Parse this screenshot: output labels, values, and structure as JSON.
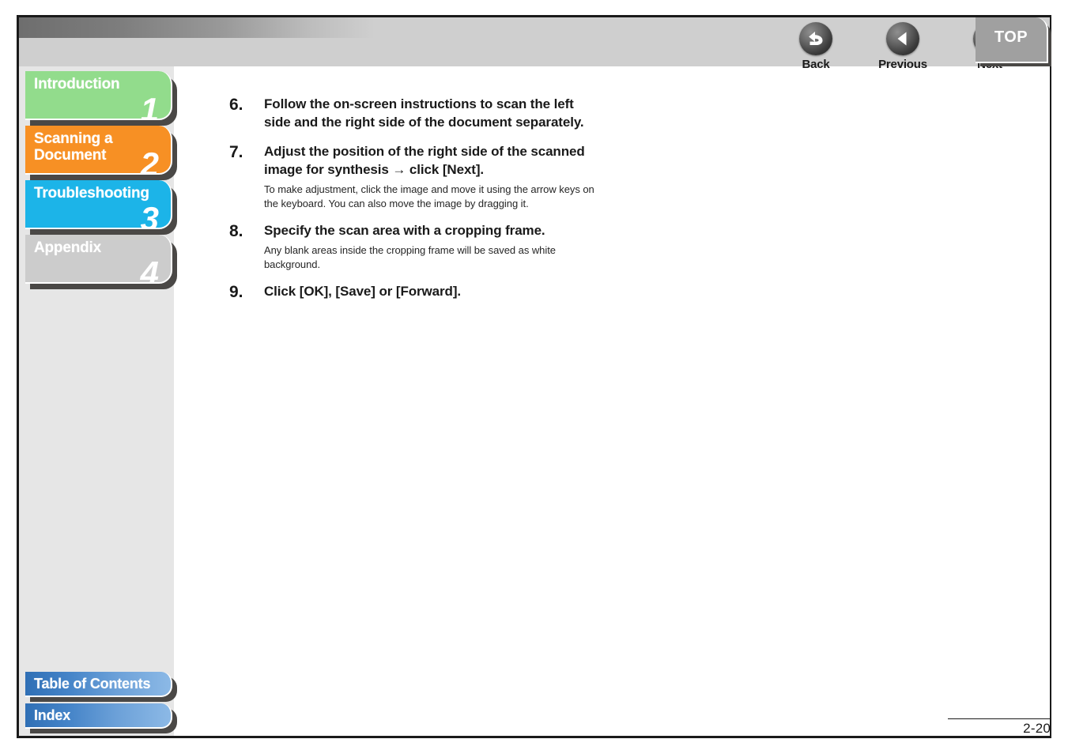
{
  "document": {
    "page_number": "2-20"
  },
  "header": {
    "nav_buttons": [
      {
        "label": "Back",
        "icon": "back-arrow-icon"
      },
      {
        "label": "Previous",
        "icon": "left-triangle-icon"
      },
      {
        "label": "Next",
        "icon": "right-triangle-icon"
      }
    ],
    "top_tab": {
      "label": "TOP",
      "color": "#a0a0a0"
    }
  },
  "sidebar": {
    "chapters": [
      {
        "label": "Introduction",
        "number": "1",
        "color": "#92dc8c"
      },
      {
        "label": "Scanning a\nDocument",
        "number": "2",
        "color": "#f79024"
      },
      {
        "label": "Troubleshooting",
        "number": "3",
        "color": "#1cb4e8"
      },
      {
        "label": "Appendix",
        "number": "4",
        "color": "#cccccc"
      }
    ],
    "bottom_tabs": [
      {
        "label": "Table of Contents"
      },
      {
        "label": "Index"
      }
    ]
  },
  "main": {
    "steps": [
      {
        "number": "6.",
        "title": "Follow the on-screen instructions to scan the left side and the right side of the document separately.",
        "description": ""
      },
      {
        "number": "7.",
        "title": "Adjust the position of the right side of the scanned image for synthesis → click [Next].",
        "description": "To make adjustment, click the image and move it using the arrow keys on the keyboard. You can also move the image by dragging it."
      },
      {
        "number": "8.",
        "title": "Specify the scan area with a cropping frame.",
        "description": "Any blank areas inside the cropping frame will be saved as white background."
      },
      {
        "number": "9.",
        "title": "Click [OK], [Save] or [Forward].",
        "description": ""
      }
    ]
  }
}
